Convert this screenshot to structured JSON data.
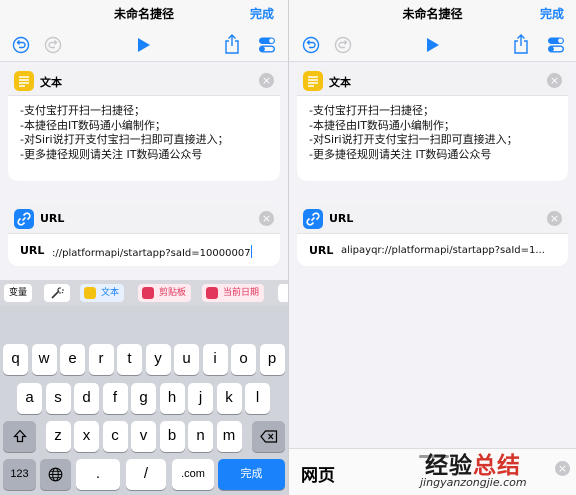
{
  "nav": {
    "title": "未命名捷径",
    "done": "完成"
  },
  "text_card": {
    "title": "文本",
    "lines": [
      "-支付宝打开扫一扫捷径；",
      "-本捷径由IT数码通小编制作；",
      "-对Siri说打开支付宝扫一扫即可直接进入；",
      "-更多捷径规则请关注 IT数码通公众号"
    ]
  },
  "url_card": {
    "title": "URL",
    "label": "URL",
    "value_left": "://platformapi/startapp?saId=10000007",
    "value_right": "alipayqr://platformapi/startapp?saId=1..."
  },
  "variables_bar": {
    "items": [
      "变量",
      "文本",
      "剪贴板",
      "当前日期"
    ]
  },
  "keyboard": {
    "row1": [
      "q",
      "w",
      "e",
      "r",
      "t",
      "y",
      "u",
      "i",
      "o",
      "p"
    ],
    "row2": [
      "a",
      "s",
      "d",
      "f",
      "g",
      "h",
      "j",
      "k",
      "l"
    ],
    "row3": [
      "z",
      "x",
      "c",
      "v",
      "b",
      "n",
      "m"
    ],
    "numbers_key": "123",
    "dot_key": ".",
    "slash_key": "/",
    "com_key": ".com",
    "done_key": "完成"
  },
  "bottom_panel": {
    "label": "网页"
  },
  "watermark": {
    "title_main": "经验",
    "title_accent": "总结",
    "url": "jingyanzongjie.com"
  },
  "colors": {
    "accent": "#1a82fb",
    "text_badge": "#f5c211",
    "url_badge": "#1a82fb",
    "pink": "#e2365b"
  }
}
